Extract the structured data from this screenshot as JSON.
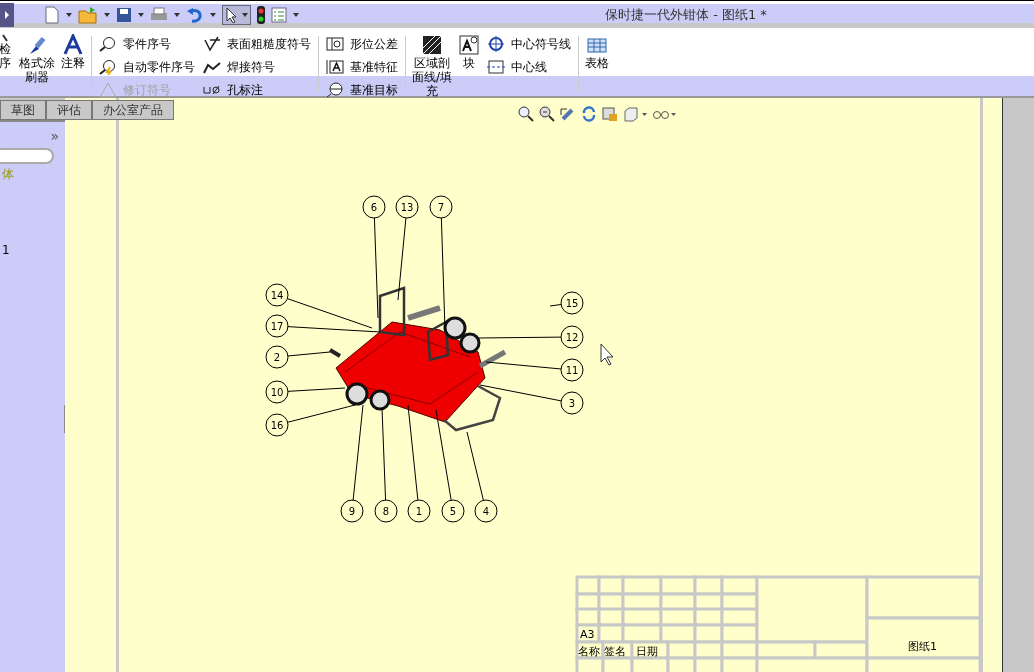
{
  "window": {
    "title": "保时捷一代外钳体 - 图纸1 *"
  },
  "ribbon": {
    "columns": [
      {
        "kind": "large",
        "lines": [
          "检",
          "序"
        ]
      },
      {
        "kind": "large",
        "lines": [
          "格式涂",
          "刷器"
        ]
      },
      {
        "kind": "large",
        "lines": [
          "注释"
        ]
      },
      {
        "kind": "small",
        "items": [
          {
            "label": "零件序号",
            "disabled": false
          },
          {
            "label": "自动零件序号",
            "disabled": false
          },
          {
            "label": "修订符号",
            "disabled": true
          }
        ]
      },
      {
        "kind": "small",
        "items": [
          {
            "label": "表面粗糙度符号",
            "disabled": false
          },
          {
            "label": "焊接符号",
            "disabled": false
          },
          {
            "label": "孔标注",
            "disabled": false
          }
        ]
      },
      {
        "kind": "small",
        "items": [
          {
            "label": "形位公差",
            "disabled": false
          },
          {
            "label": "基准特征",
            "disabled": false
          },
          {
            "label": "基准目标",
            "disabled": false
          }
        ]
      },
      {
        "kind": "large",
        "lines": [
          "区域剖",
          "面线/填",
          "充"
        ]
      },
      {
        "kind": "large",
        "lines": [
          "块"
        ]
      },
      {
        "kind": "small",
        "items": [
          {
            "label": "中心符号线",
            "disabled": false
          },
          {
            "label": "中心线",
            "disabled": false
          }
        ]
      },
      {
        "kind": "large",
        "lines": [
          "表格"
        ]
      }
    ]
  },
  "tabs": [
    {
      "label": "草图",
      "selected": false
    },
    {
      "label": "评估",
      "selected": false
    },
    {
      "label": "办公室产品",
      "selected": false
    }
  ],
  "left_panel": {
    "expand_glyph": "»",
    "tree_items": [
      {
        "label": "体",
        "highlighted": true
      },
      {
        "label": "1",
        "highlighted": false
      }
    ]
  },
  "drawing": {
    "balloons": [
      "6",
      "13",
      "7",
      "14",
      "15",
      "17",
      "12",
      "2",
      "11",
      "10",
      "3",
      "16",
      "9",
      "8",
      "1",
      "5",
      "4"
    ]
  },
  "title_block": {
    "sheet_size": "A3",
    "header_cells": [
      "名称",
      "签名",
      "日期"
    ],
    "sheet_name": "图纸1"
  }
}
